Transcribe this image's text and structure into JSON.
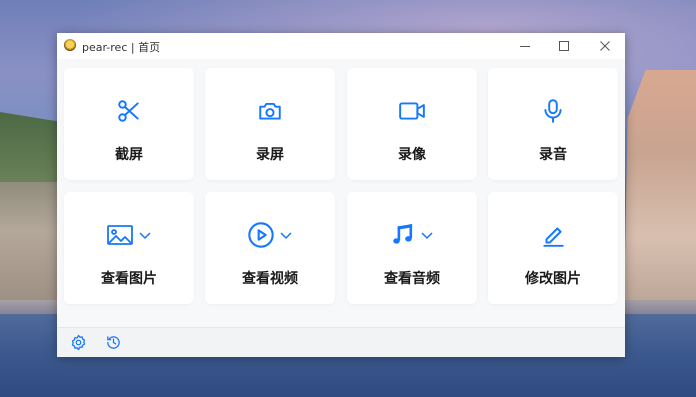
{
  "window": {
    "title": "pear-rec | 首页",
    "controls": {
      "minimize": "minimize-icon",
      "maximize": "maximize-icon",
      "close": "close-icon"
    }
  },
  "cards": [
    {
      "label": "截屏",
      "icon": "scissors-icon",
      "dropdown": false
    },
    {
      "label": "录屏",
      "icon": "camera-icon",
      "dropdown": false
    },
    {
      "label": "录像",
      "icon": "video-camera-icon",
      "dropdown": false
    },
    {
      "label": "录音",
      "icon": "microphone-icon",
      "dropdown": false
    },
    {
      "label": "查看图片",
      "icon": "image-icon",
      "dropdown": true
    },
    {
      "label": "查看视频",
      "icon": "play-circle-icon",
      "dropdown": true
    },
    {
      "label": "查看音频",
      "icon": "music-note-icon",
      "dropdown": true
    },
    {
      "label": "修改图片",
      "icon": "pencil-icon",
      "dropdown": false
    }
  ],
  "footer": {
    "icons": [
      "settings-icon",
      "history-icon"
    ]
  },
  "colors": {
    "accent": "#1677ff",
    "window_bg": "#ffffff",
    "content_bg": "#f7f8fa"
  }
}
